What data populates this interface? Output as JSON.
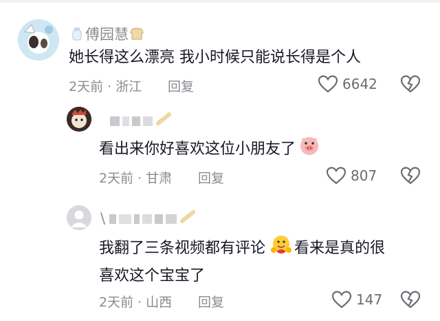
{
  "comments": [
    {
      "username": "傅园慧",
      "text": "她长得这么漂亮 我小时候只能说长得是个人",
      "time": "2天前",
      "location": "浙江",
      "reply_label": "回复",
      "likes": "6642"
    },
    {
      "username": "",
      "text": "看出来你好喜欢这位小朋友了",
      "time": "2天前",
      "location": "甘肃",
      "reply_label": "回复",
      "likes": "807"
    },
    {
      "username": "\\",
      "text_line1": "我翻了三条视频都有评论",
      "text_line1b": "看来是真的很",
      "text_line2": "喜欢这个宝宝了",
      "time": "2天前",
      "location": "山西",
      "reply_label": "回复",
      "likes": "147"
    }
  ],
  "separator": "·",
  "icons": {
    "like": "heart-outline-icon",
    "dislike": "broken-heart-icon",
    "emoji1": "pig-face-emoji",
    "emoji2": "hug-face-emoji",
    "badge": "baby-bottle-icon"
  }
}
